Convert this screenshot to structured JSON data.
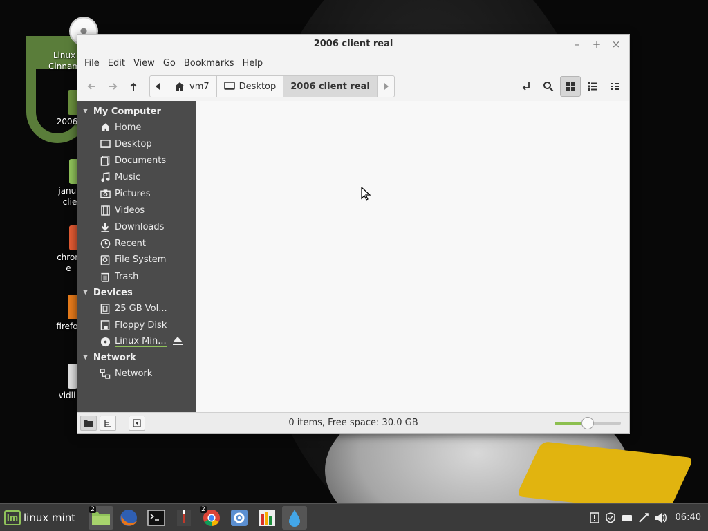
{
  "desktop": {
    "icons": [
      {
        "label": "Linux\nCinnam",
        "color": "#6a8f3d"
      },
      {
        "label": "2006",
        "color": "#6a8f3d"
      },
      {
        "label": "janua\nclie",
        "color": "#8fc25a"
      },
      {
        "label": "chron\ne",
        "color": "#e25b33"
      },
      {
        "label": "firefo",
        "color": "#e77b1b"
      },
      {
        "label": "vidli",
        "color": "#e0e0e0"
      }
    ]
  },
  "window": {
    "title": "2006 client real",
    "controls": {
      "minimize": "–",
      "maximize": "+",
      "close": "×"
    },
    "menu": [
      "File",
      "Edit",
      "View",
      "Go",
      "Bookmarks",
      "Help"
    ],
    "breadcrumbs": {
      "home": "vm7",
      "desktop": "Desktop",
      "current": "2006 client real"
    },
    "sidebar": {
      "sections": [
        {
          "title": "My Computer",
          "items": [
            {
              "label": "Home",
              "icon": "home-icon"
            },
            {
              "label": "Desktop",
              "icon": "desktop-icon"
            },
            {
              "label": "Documents",
              "icon": "documents-icon"
            },
            {
              "label": "Music",
              "icon": "music-icon"
            },
            {
              "label": "Pictures",
              "icon": "pictures-icon"
            },
            {
              "label": "Videos",
              "icon": "videos-icon"
            },
            {
              "label": "Downloads",
              "icon": "downloads-icon"
            },
            {
              "label": "Recent",
              "icon": "recent-icon"
            },
            {
              "label": "File System",
              "icon": "filesystem-icon"
            },
            {
              "label": "Trash",
              "icon": "trash-icon"
            }
          ]
        },
        {
          "title": "Devices",
          "items": [
            {
              "label": "25 GB Vol...",
              "icon": "drive-icon"
            },
            {
              "label": "Floppy Disk",
              "icon": "floppy-icon"
            },
            {
              "label": "Linux Min...",
              "icon": "disc-icon"
            }
          ]
        },
        {
          "title": "Network",
          "items": [
            {
              "label": "Network",
              "icon": "network-icon"
            }
          ]
        }
      ]
    },
    "status": "0 items, Free space: 30.0 GB",
    "zoom_level": 0.5
  },
  "taskbar": {
    "menu_label": "linux mint",
    "badges": {
      "files": "2",
      "chrome": "2"
    },
    "clock": "06:40"
  },
  "colors": {
    "accent": "#8fc25a",
    "sidebar_bg": "#4b4b4b",
    "taskbar_bg": "#3a3a3a"
  }
}
